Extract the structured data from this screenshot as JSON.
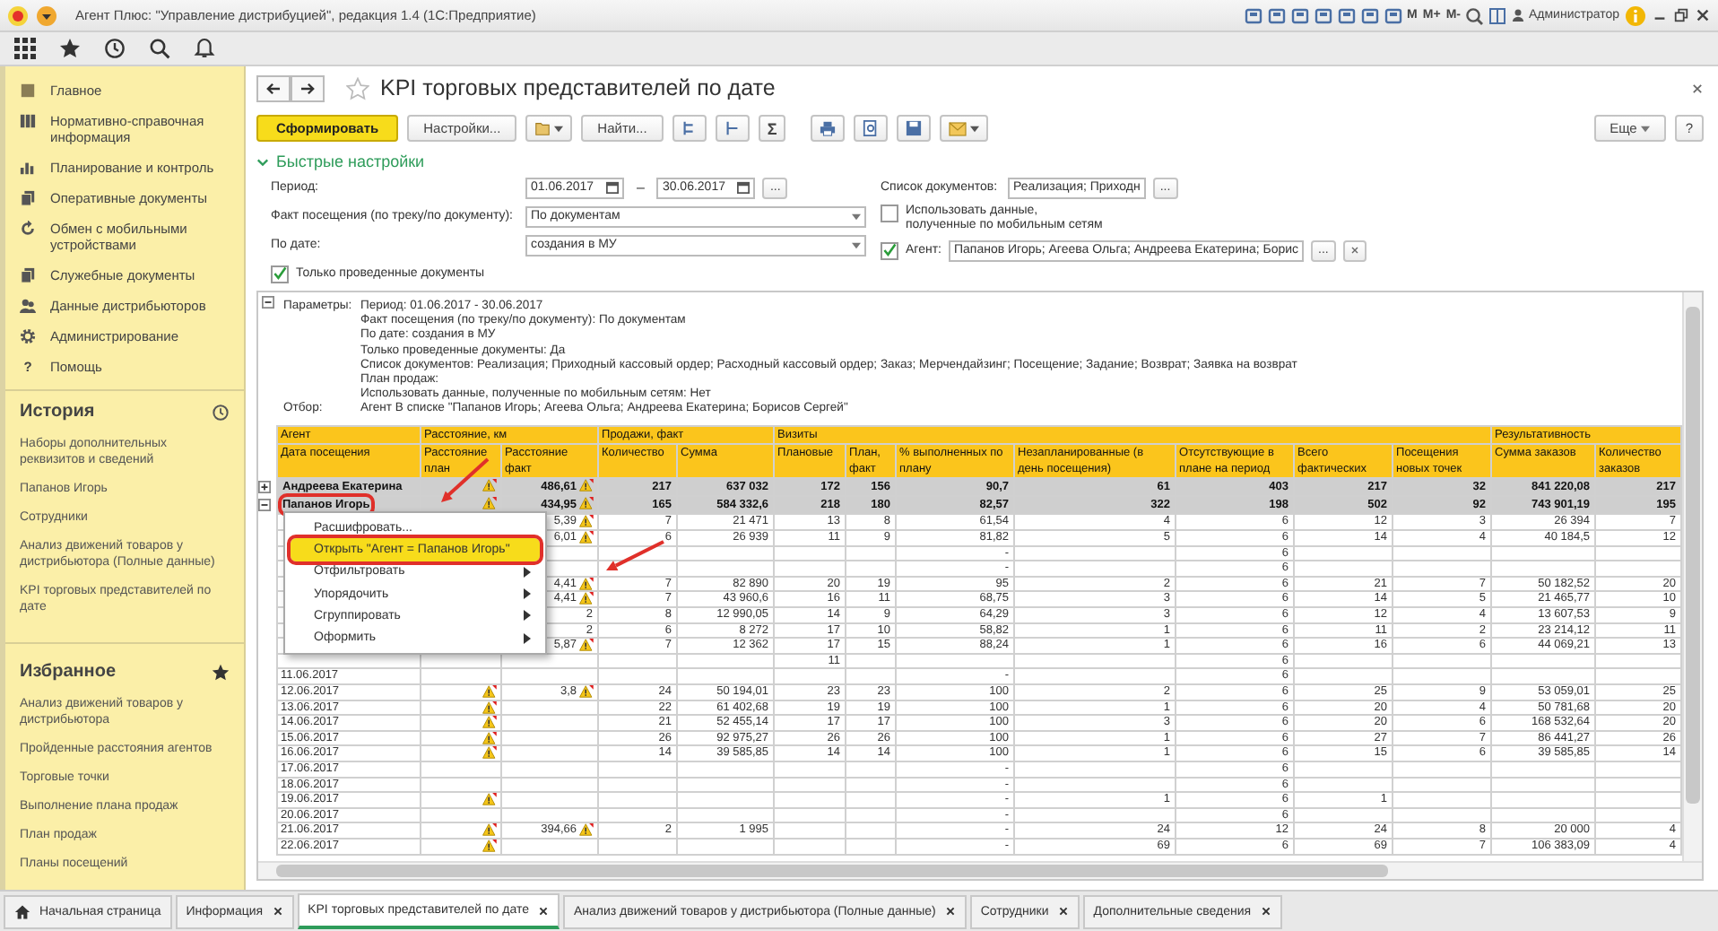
{
  "title_bar": {
    "title": "Агент Плюс: \"Управление дистрибуцией\", редакция 1.4 (1С:Предприятие)",
    "memory_buttons": [
      "M",
      "M+",
      "M-"
    ],
    "user": "Администратор"
  },
  "sidebar": {
    "items": [
      {
        "label": "Главное"
      },
      {
        "label": "Нормативно-справочная информация"
      },
      {
        "label": "Планирование и контроль"
      },
      {
        "label": "Оперативные документы"
      },
      {
        "label": "Обмен с мобильными устройствами"
      },
      {
        "label": "Служебные документы"
      },
      {
        "label": "Данные дистрибьюторов"
      },
      {
        "label": "Администрирование"
      },
      {
        "label": "Помощь",
        "glyph": "?"
      }
    ],
    "history": {
      "title": "История",
      "items": [
        "Наборы дополнительных реквизитов и сведений",
        "Папанов Игорь",
        "Сотрудники",
        "Анализ движений товаров у дистрибьютора (Полные данные)",
        "KPI торговых представителей по дате"
      ]
    },
    "favorites": {
      "title": "Избранное",
      "items": [
        "Анализ движений товаров у дистрибьютора",
        "Пройденные расстояния агентов",
        "Торговые точки",
        "Выполнение плана продаж",
        "План продаж",
        "Планы посещений"
      ]
    }
  },
  "page": {
    "title": "KPI торговых представителей по дате",
    "favorite": false,
    "toolbar": {
      "generate": "Сформировать",
      "settings": "Настройки...",
      "find": "Найти...",
      "sum": "Σ",
      "more": "Еще",
      "help": "?"
    },
    "quick_settings": {
      "title": "Быстрые настройки",
      "expanded": true,
      "period": {
        "label": "Период:",
        "from": "01.06.2017",
        "separator": "–",
        "to": "30.06.2017",
        "choice": "..."
      },
      "visit_fact": {
        "label": "Факт посещения (по треку/по документу):",
        "value": "По документам"
      },
      "by_date": {
        "label": "По дате:",
        "value": "создания в МУ"
      },
      "posted_only": {
        "label": "Только проведенные документы",
        "checked": true
      },
      "documents": {
        "label": "Список документов:",
        "value": "Реализация; Приходн",
        "choice": "..."
      },
      "mobile_data": {
        "label": "Использовать данные,\nполученные по мобильным сетям",
        "checked": false
      },
      "agent": {
        "label": "Агент:",
        "checked": true,
        "value": "Папанов Игорь; Агеева Ольга; Андреева Екатерина; Борис",
        "choice": "..."
      }
    },
    "report": {
      "parameters_label": "Параметры:",
      "parameters": [
        "Период: 01.06.2017 - 30.06.2017",
        "Факт посещения (по треку/по документу): По документам",
        "По дате: создания в МУ",
        "Только проведенные документы: Да",
        "Список документов: Реализация; Приходный кассовый ордер; Расходный кассовый ордер; Заказ; Мерчендайзинг; Посещение; Задание; Возврат; Заявка на возврат",
        "План продаж:",
        "Использовать данные, полученные по мобильным сетям: Нет"
      ],
      "filter_label": "Отбор:",
      "filter": "Агент В списке \"Папанов Игорь; Агеева Ольга; Андреева Екатерина; Борисов Сергей\"",
      "column_groups": [
        {
          "label": "Агент",
          "columns": [
            "Дата посещения"
          ]
        },
        {
          "label": "Расстояние, км",
          "columns": [
            "Расстояние план",
            "Расстояние факт"
          ]
        },
        {
          "label": "Продажи, факт",
          "columns": [
            "Количество",
            "Сумма"
          ]
        },
        {
          "label": "Визиты",
          "columns": [
            "Плановые",
            "План, факт",
            "% выполненных по плану",
            "Незапланированные (в день посещения)",
            "Отсутствующие в плане на период",
            "Всего фактических",
            "Посещения новых точек"
          ]
        },
        {
          "label": "Результативность",
          "columns": [
            "Сумма заказов",
            "Количество заказов"
          ]
        }
      ],
      "rows": [
        {
          "kind": "group",
          "expanded": false,
          "highlighted": false,
          "plan_warning": true,
          "fact_warning": true,
          "cells": [
            "Андреева Екатерина",
            null,
            "486,61",
            "217",
            "637 032",
            "172",
            "156",
            "90,7",
            "61",
            "403",
            "217",
            "32",
            "841 220,08",
            "217"
          ]
        },
        {
          "kind": "group",
          "expanded": true,
          "highlighted": true,
          "plan_warning": true,
          "fact_warning": true,
          "cells": [
            "Папанов Игорь",
            null,
            "434,95",
            "165",
            "584 332,6",
            "218",
            "180",
            "82,57",
            "322",
            "198",
            "502",
            "92",
            "743 901,19",
            "195"
          ]
        },
        {
          "kind": "date",
          "fact_warning": true,
          "cells": [
            null,
            null,
            "5,39",
            "7",
            "21 471",
            "13",
            "8",
            "61,54",
            "4",
            "6",
            "12",
            "3",
            "26 394",
            "7"
          ]
        },
        {
          "kind": "date",
          "fact_warning": true,
          "cells": [
            null,
            null,
            "6,01",
            "6",
            "26 939",
            "11",
            "9",
            "81,82",
            "5",
            "6",
            "14",
            "4",
            "40 184,5",
            "12"
          ]
        },
        {
          "kind": "date",
          "fact_warning": false,
          "cells": [
            null,
            null,
            null,
            null,
            null,
            null,
            null,
            "-",
            null,
            "6",
            null,
            null,
            null,
            null
          ]
        },
        {
          "kind": "date",
          "fact_warning": false,
          "cells": [
            null,
            null,
            null,
            null,
            null,
            null,
            null,
            "-",
            null,
            "6",
            null,
            null,
            null,
            null
          ]
        },
        {
          "kind": "date",
          "fact_warning": true,
          "cells": [
            null,
            null,
            "4,41",
            "7",
            "82 890",
            "20",
            "19",
            "95",
            "2",
            "6",
            "21",
            "7",
            "50 182,52",
            "20"
          ]
        },
        {
          "kind": "date",
          "fact_warning": true,
          "cells": [
            null,
            null,
            "4,41",
            "7",
            "43 960,6",
            "16",
            "11",
            "68,75",
            "3",
            "6",
            "14",
            "5",
            "21 465,77",
            "10"
          ]
        },
        {
          "kind": "date",
          "fact_warning": false,
          "cells": [
            null,
            null,
            "2",
            "8",
            "12 990,05",
            "14",
            "9",
            "64,29",
            "3",
            "6",
            "12",
            "4",
            "13 607,53",
            "9"
          ]
        },
        {
          "kind": "date",
          "fact_warning": false,
          "cells": [
            null,
            null,
            "2",
            "6",
            "8 272",
            "17",
            "10",
            "58,82",
            "1",
            "6",
            "11",
            "2",
            "23 214,12",
            "11"
          ]
        },
        {
          "kind": "date",
          "fact_warning": true,
          "cells": [
            null,
            null,
            "5,87",
            "7",
            "12 362",
            "17",
            "15",
            "88,24",
            "1",
            "6",
            "16",
            "6",
            "44 069,21",
            "13"
          ]
        },
        {
          "kind": "date",
          "fact_warning": false,
          "cells": [
            null,
            null,
            null,
            null,
            null,
            "11",
            null,
            null,
            null,
            "6",
            null,
            null,
            null,
            null
          ]
        },
        {
          "kind": "date",
          "plan_warning": false,
          "fact_warning": false,
          "cells": [
            "11.06.2017",
            null,
            null,
            null,
            null,
            null,
            null,
            "-",
            null,
            "6",
            null,
            null,
            null,
            null
          ]
        },
        {
          "kind": "date",
          "plan_warning": true,
          "fact_warning": true,
          "cells": [
            "12.06.2017",
            null,
            "3,8",
            "24",
            "50 194,01",
            "23",
            "23",
            "100",
            "2",
            "6",
            "25",
            "9",
            "53 059,01",
            "25"
          ]
        },
        {
          "kind": "date",
          "plan_warning": true,
          "fact_warning": false,
          "cells": [
            "13.06.2017",
            null,
            null,
            "22",
            "61 402,68",
            "19",
            "19",
            "100",
            "1",
            "6",
            "20",
            "4",
            "50 781,68",
            "20"
          ]
        },
        {
          "kind": "date",
          "plan_warning": true,
          "fact_warning": false,
          "cells": [
            "14.06.2017",
            null,
            null,
            "21",
            "52 455,14",
            "17",
            "17",
            "100",
            "3",
            "6",
            "20",
            "6",
            "168 532,64",
            "20"
          ]
        },
        {
          "kind": "date",
          "plan_warning": true,
          "fact_warning": false,
          "cells": [
            "15.06.2017",
            null,
            null,
            "26",
            "92 975,27",
            "26",
            "26",
            "100",
            "1",
            "6",
            "27",
            "7",
            "86 441,27",
            "26"
          ]
        },
        {
          "kind": "date",
          "plan_warning": true,
          "fact_warning": false,
          "cells": [
            "16.06.2017",
            null,
            null,
            "14",
            "39 585,85",
            "14",
            "14",
            "100",
            "1",
            "6",
            "15",
            "6",
            "39 585,85",
            "14"
          ]
        },
        {
          "kind": "date",
          "plan_warning": false,
          "fact_warning": false,
          "cells": [
            "17.06.2017",
            null,
            null,
            null,
            null,
            null,
            null,
            "-",
            null,
            "6",
            null,
            null,
            null,
            null
          ]
        },
        {
          "kind": "date",
          "plan_warning": false,
          "fact_warning": false,
          "cells": [
            "18.06.2017",
            null,
            null,
            null,
            null,
            null,
            null,
            "-",
            null,
            "6",
            null,
            null,
            null,
            null
          ]
        },
        {
          "kind": "date",
          "plan_warning": true,
          "fact_warning": false,
          "cells": [
            "19.06.2017",
            null,
            null,
            null,
            null,
            null,
            null,
            "-",
            "1",
            "6",
            "1",
            null,
            null,
            null
          ]
        },
        {
          "kind": "date",
          "plan_warning": false,
          "fact_warning": false,
          "cells": [
            "20.06.2017",
            null,
            null,
            null,
            null,
            null,
            null,
            "-",
            null,
            "6",
            null,
            null,
            null,
            null
          ]
        },
        {
          "kind": "date",
          "plan_warning": true,
          "fact_warning": true,
          "cells": [
            "21.06.2017",
            null,
            "394,66",
            "2",
            "1 995",
            null,
            null,
            "-",
            "24",
            "12",
            "24",
            "8",
            "20 000",
            "4"
          ]
        },
        {
          "kind": "date",
          "plan_warning": true,
          "fact_warning": false,
          "cells": [
            "22.06.2017",
            null,
            null,
            null,
            null,
            null,
            null,
            "-",
            "69",
            "6",
            "69",
            "7",
            "106 383,09",
            "4"
          ]
        }
      ],
      "context_menu": {
        "items": [
          {
            "label": "Расшифровать...",
            "selected": false,
            "submenu": false
          },
          {
            "label": "Открыть \"Агент = Папанов Игорь\"",
            "selected": true,
            "submenu": false
          },
          {
            "label": "Отфильтровать",
            "selected": false,
            "submenu": true
          },
          {
            "label": "Упорядочить",
            "selected": false,
            "submenu": true
          },
          {
            "label": "Сгруппировать",
            "selected": false,
            "submenu": true
          },
          {
            "label": "Оформить",
            "selected": false,
            "submenu": true
          }
        ]
      }
    }
  },
  "tabs": [
    {
      "label": "Начальная страница",
      "kind": "home",
      "selected": false
    },
    {
      "label": "Информация",
      "kind": "closable",
      "selected": false
    },
    {
      "label": "KPI торговых представителей по дате",
      "kind": "closable",
      "selected": true
    },
    {
      "label": "Анализ движений товаров у дистрибьютора (Полные данные)",
      "kind": "closable",
      "selected": false
    },
    {
      "label": "Сотрудники",
      "kind": "closable",
      "selected": false
    },
    {
      "label": "Дополнительные сведения",
      "kind": "closable",
      "selected": false
    }
  ]
}
